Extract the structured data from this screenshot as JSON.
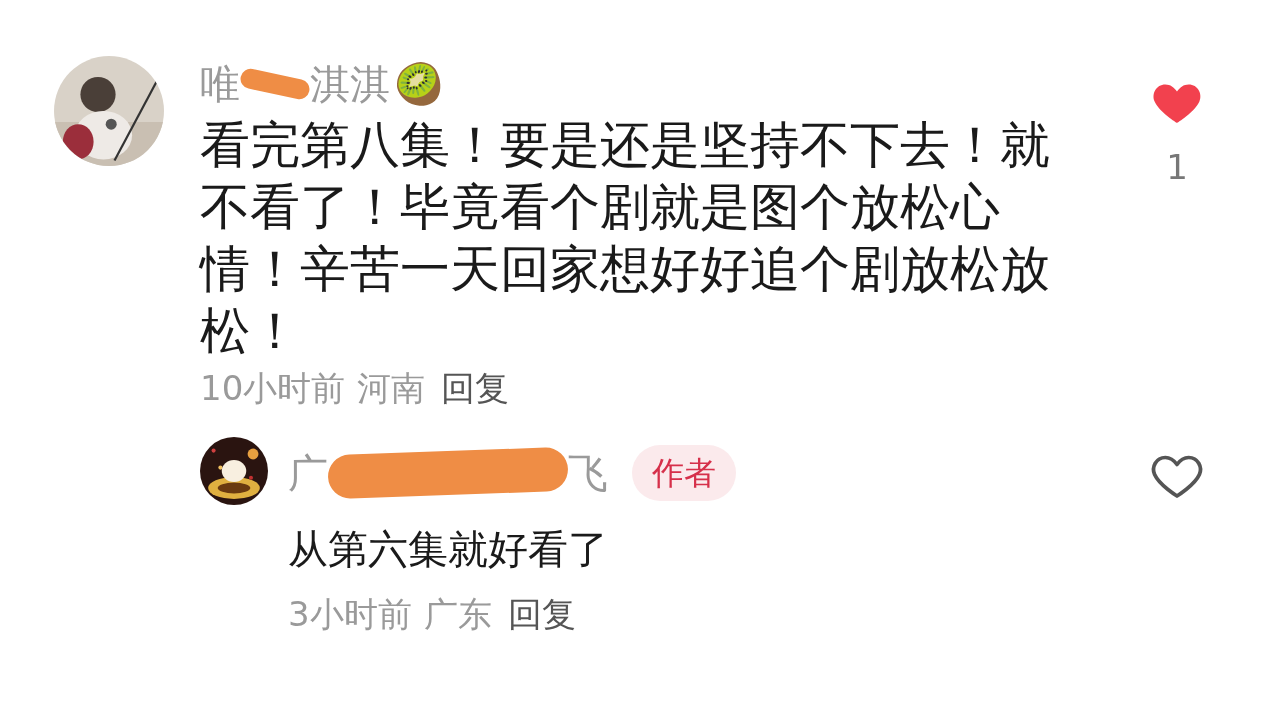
{
  "comments": [
    {
      "kind": "comment",
      "name_parts": [
        "唯",
        "淇淇"
      ],
      "emoji": "🥝",
      "text": "看完第八集！要是还是坚持不下去！就不看了！毕竟看个剧就是图个放松心情！辛苦一天回家想好好追个剧放松放松！",
      "time": "10小时前",
      "location": "河南",
      "reply": "回复",
      "liked": true,
      "likes": "1"
    },
    {
      "kind": "reply",
      "name_parts": [
        "广",
        "飞"
      ],
      "badge": "作者",
      "text": "从第六集就好看了",
      "time": "3小时前",
      "location": "广东",
      "reply": "回复",
      "liked": false
    }
  ]
}
